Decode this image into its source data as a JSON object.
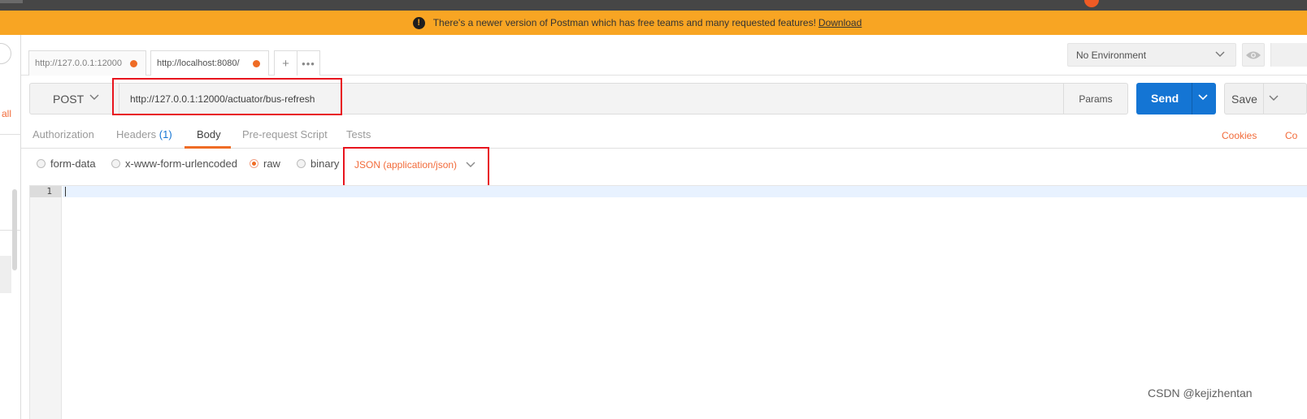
{
  "banner": {
    "message": "There's a newer version of Postman which has free teams and many requested features!",
    "link": "Download"
  },
  "sidebar": {
    "fragment": "all"
  },
  "tabs": [
    {
      "label": "http://127.0.0.1:12000",
      "unsaved": true
    },
    {
      "label": "http://localhost:8080/",
      "unsaved": true
    }
  ],
  "tab_actions": {
    "add": "+",
    "more": "•••"
  },
  "environment": {
    "selected": "No Environment"
  },
  "request": {
    "method": "POST",
    "url": "http://127.0.0.1:12000/actuator/bus-refresh",
    "params_label": "Params",
    "send_label": "Send",
    "save_label": "Save"
  },
  "subtabs": {
    "authorization": "Authorization",
    "headers": "Headers",
    "headers_count": "(1)",
    "body": "Body",
    "prerequest": "Pre-request Script",
    "tests": "Tests",
    "cookies": "Cookies",
    "code": "Co"
  },
  "body_types": {
    "form_data": "form-data",
    "urlencoded": "x-www-form-urlencoded",
    "raw": "raw",
    "binary": "binary",
    "selected": "raw",
    "content_type": "JSON (application/json)"
  },
  "editor": {
    "line_numbers": [
      "1"
    ]
  },
  "watermark": "CSDN @kejizhentan",
  "colors": {
    "accent": "#ef6c25",
    "send": "#1475d4",
    "banner": "#f8a523",
    "highlight": "#e8141e"
  }
}
